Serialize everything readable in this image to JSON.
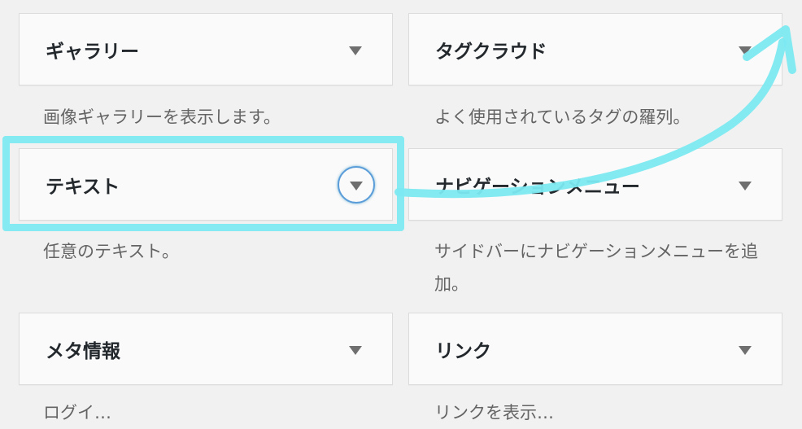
{
  "widgets": [
    {
      "title": "ギャラリー",
      "description": "画像ギャラリーを表示します。"
    },
    {
      "title": "タグクラウド",
      "description": "よく使用されているタグの羅列。"
    },
    {
      "title": "テキスト",
      "description": "任意のテキスト。"
    },
    {
      "title": "ナビゲーションメニュー",
      "description": "サイドバーにナビゲーションメニューを追加。"
    },
    {
      "title": "メタ情報",
      "description": "ログイ…"
    },
    {
      "title": "リンク",
      "description": "リンクを表示…"
    }
  ],
  "annotation": {
    "color": "#7ce9f1"
  },
  "colors": {
    "background": "#f1f1f1",
    "widget_bg": "#fafafa",
    "focus_ring": "#5b9dd9"
  }
}
